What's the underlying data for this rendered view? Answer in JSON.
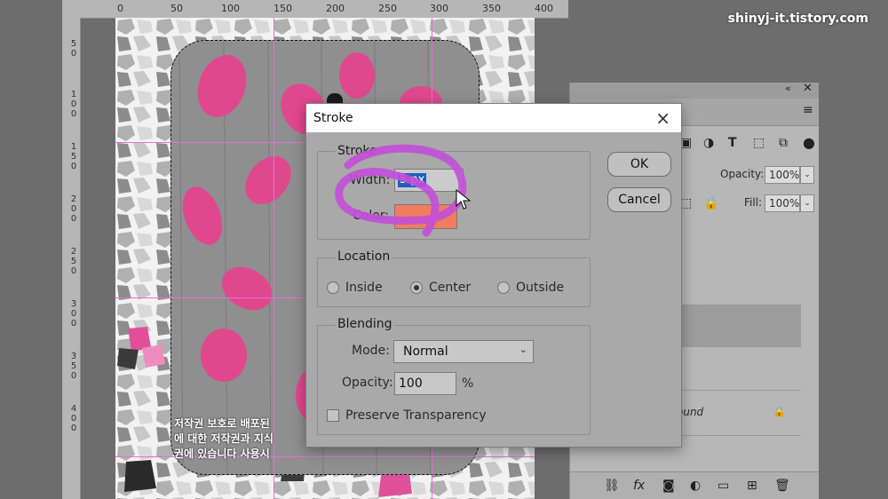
{
  "watermark": "shinyj-it.tistory.com",
  "rulers": {
    "top_labels": [
      "0",
      "50",
      "100",
      "150",
      "200",
      "250",
      "300",
      "350",
      "400"
    ],
    "left_labels": [
      "5",
      "0",
      "1",
      "0",
      "0",
      "1",
      "5",
      "0",
      "2",
      "0",
      "0",
      "2",
      "5",
      "0",
      "3",
      "0",
      "0",
      "3",
      "5",
      "0",
      "4",
      "0",
      "0"
    ]
  },
  "canvas_text": {
    "line1": "저작권 보호로 배포된",
    "line2": "에 대한 저작권과 지식",
    "line3": "권에 있습니다 사용시 "
  },
  "layers_panel": {
    "opacity_label": "Opacity:",
    "opacity_value": "100%",
    "fill_label": "Fill:",
    "fill_value": "100%",
    "background_layer": "ound"
  },
  "dialog": {
    "title": "Stroke",
    "stroke_group": {
      "title": "Stroke",
      "width_label": "Width:",
      "width_value": "5 px",
      "color_label": "Color:",
      "color_hex": "#ef7d5e"
    },
    "location_group": {
      "title": "Location",
      "options": [
        "Inside",
        "Center",
        "Outside"
      ],
      "selected": "Center"
    },
    "blending_group": {
      "title": "Blending",
      "mode_label": "Mode:",
      "mode_value": "Normal",
      "opacity_label": "Opacity:",
      "opacity_value": "100",
      "opacity_unit": "%",
      "preserve_label": "Preserve Transparency"
    },
    "ok_label": "OK",
    "cancel_label": "Cancel"
  },
  "colors": {
    "highlight_scribble": "#c24fd8",
    "guide": "#e76fd8",
    "accent_select": "#1f5fbf"
  }
}
